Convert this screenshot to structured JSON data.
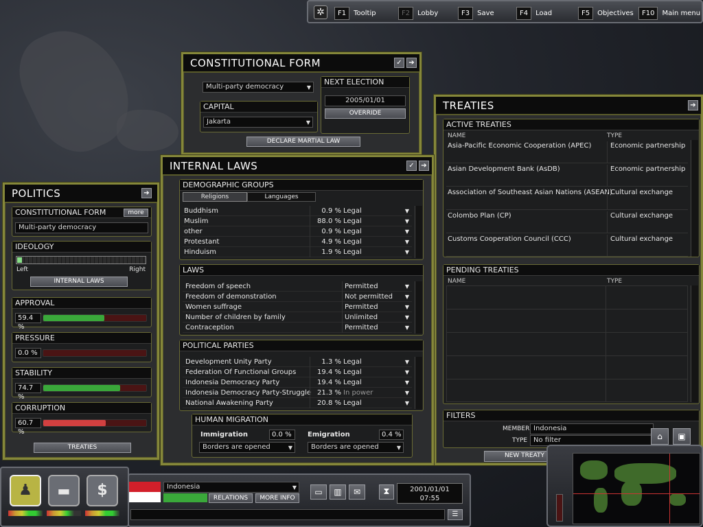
{
  "topbar": {
    "keys": [
      {
        "key": "F1",
        "label": "Tooltip"
      },
      {
        "key": "F2",
        "label": "Lobby"
      },
      {
        "key": "F3",
        "label": "Save"
      },
      {
        "key": "F4",
        "label": "Load"
      },
      {
        "key": "F5",
        "label": "Objectives"
      },
      {
        "key": "F10",
        "label": "Main menu"
      }
    ]
  },
  "constitutional": {
    "title": "CONSTITUTIONAL FORM",
    "form": "Multi-party democracy",
    "next_election_label": "NEXT ELECTION",
    "next_election_date": "2005/01/01",
    "override": "OVERRIDE",
    "capital_label": "CAPITAL",
    "capital": "Jakarta",
    "martial_law": "DECLARE MARTIAL LAW"
  },
  "politics": {
    "title": "POLITICS",
    "form_label": "CONSTITUTIONAL FORM",
    "more": "more",
    "form": "Multi-party democracy",
    "ideology_label": "IDEOLOGY",
    "ideology_left": "Left",
    "ideology_right": "Right",
    "ideology_value": 0.0,
    "internal_laws_btn": "INTERNAL LAWS",
    "stats": [
      {
        "label": "APPROVAL",
        "value": "59.4 %",
        "level": 0.594,
        "color": "#3aa83a"
      },
      {
        "label": "PRESSURE",
        "value": "0.0 %",
        "level": 0.0,
        "color": "#3aa83a"
      },
      {
        "label": "STABILITY",
        "value": "74.7 %",
        "level": 0.747,
        "color": "#3aa83a"
      },
      {
        "label": "CORRUPTION",
        "value": "60.7 %",
        "level": 0.607,
        "color": "#d24040"
      }
    ],
    "treaties_btn": "TREATIES"
  },
  "internal": {
    "title": "INTERNAL LAWS",
    "demo_label": "DEMOGRAPHIC GROUPS",
    "tab_religions": "Religions",
    "tab_languages": "Languages",
    "religions": [
      {
        "name": "Buddhism",
        "pct": "0.9 %",
        "status": "Legal"
      },
      {
        "name": "Muslim",
        "pct": "88.0 %",
        "status": "Legal"
      },
      {
        "name": "other",
        "pct": "0.9 %",
        "status": "Legal"
      },
      {
        "name": "Protestant",
        "pct": "4.9 %",
        "status": "Legal"
      },
      {
        "name": "Hinduism",
        "pct": "1.9 %",
        "status": "Legal"
      }
    ],
    "laws_label": "LAWS",
    "laws": [
      {
        "name": "Freedom of speech",
        "value": "Permitted"
      },
      {
        "name": "Freedom of demonstration",
        "value": "Not permitted"
      },
      {
        "name": "Women suffrage",
        "value": "Permitted"
      },
      {
        "name": "Number of children by family",
        "value": "Unlimited"
      },
      {
        "name": "Contraception",
        "value": "Permitted"
      }
    ],
    "parties_label": "POLITICAL PARTIES",
    "parties": [
      {
        "name": "Development Unity Party",
        "pct": "1.3 %",
        "status": "Legal"
      },
      {
        "name": "Federation Of Functional Groups",
        "pct": "19.4 %",
        "status": "Legal"
      },
      {
        "name": "Indonesia Democracy Party",
        "pct": "19.4 %",
        "status": "Legal"
      },
      {
        "name": "Indonesia Democracy Party-Struggle",
        "pct": "21.3 %",
        "status": "In power"
      },
      {
        "name": "National Awakening Party",
        "pct": "20.8 %",
        "status": "Legal"
      }
    ],
    "migration_label": "HUMAN MIGRATION",
    "immigration_label": "Immigration",
    "immigration_pct": "0.0 %",
    "immigration_policy": "Borders are opened",
    "emigration_label": "Emigration",
    "emigration_pct": "0.4 %",
    "emigration_policy": "Borders are opened"
  },
  "treaties": {
    "title": "TREATIES",
    "active_label": "ACTIVE TREATIES",
    "col_name": "NAME",
    "col_type": "TYPE",
    "active": [
      {
        "name": "Asia-Pacific Economic Cooperation (APEC)",
        "type": "Economic partnership"
      },
      {
        "name": "Asian Development Bank (AsDB)",
        "type": "Economic partnership"
      },
      {
        "name": "Association of Southeast Asian Nations (ASEAN)",
        "type": "Cultural exchange"
      },
      {
        "name": "Colombo Plan (CP)",
        "type": "Cultural exchange"
      },
      {
        "name": "Customs Cooperation Council (CCC)",
        "type": "Cultural exchange"
      }
    ],
    "pending_label": "PENDING TREATIES",
    "filters_label": "FILTERS",
    "member_label": "MEMBER",
    "member": "Indonesia",
    "type_label": "TYPE",
    "type": "No filter",
    "new_treaty": "NEW TREATY"
  },
  "bottom": {
    "country": "Indonesia",
    "relations": "RELATIONS",
    "more_info": "MORE INFO",
    "date": "2001/01/01",
    "time": "07:55",
    "flag_colors": [
      "#d21f2a",
      "#ffffff"
    ]
  }
}
